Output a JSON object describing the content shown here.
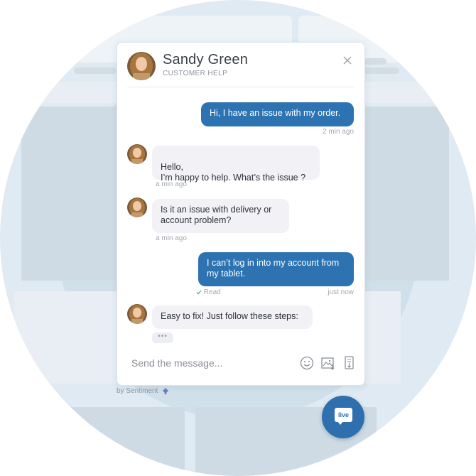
{
  "header": {
    "agent_name": "Sandy Green",
    "agent_role": "CUSTOMER HELP"
  },
  "messages": [
    {
      "from": "user",
      "text": "Hi, I have an issue with my order.",
      "time": "2 min ago"
    },
    {
      "from": "agent",
      "text": "Hello,\nI’m happy to help. What’s the issue ?",
      "time": "a min ago"
    },
    {
      "from": "agent",
      "text": "Is it an issue with delivery or account problem?",
      "time": "a min ago"
    },
    {
      "from": "user",
      "text": "I can’t log in into my account from my tablet.",
      "status": "Read",
      "time": "just now"
    },
    {
      "from": "agent",
      "text": "Easy to fix! Just follow these steps:"
    }
  ],
  "typing_indicator": "•••",
  "composer": {
    "placeholder": "Send the message..."
  },
  "icons": {
    "close": "close-icon",
    "emoji": "emoji-icon",
    "image": "image-upload-icon",
    "attach": "attachment-icon",
    "read": "checkmark-icon"
  },
  "branding": "by Sentiment",
  "live_button_label": "live",
  "colors": {
    "accent": "#2d73b2",
    "incoming_bubble": "#f1f1f6",
    "live_button": "#2f6fae"
  }
}
